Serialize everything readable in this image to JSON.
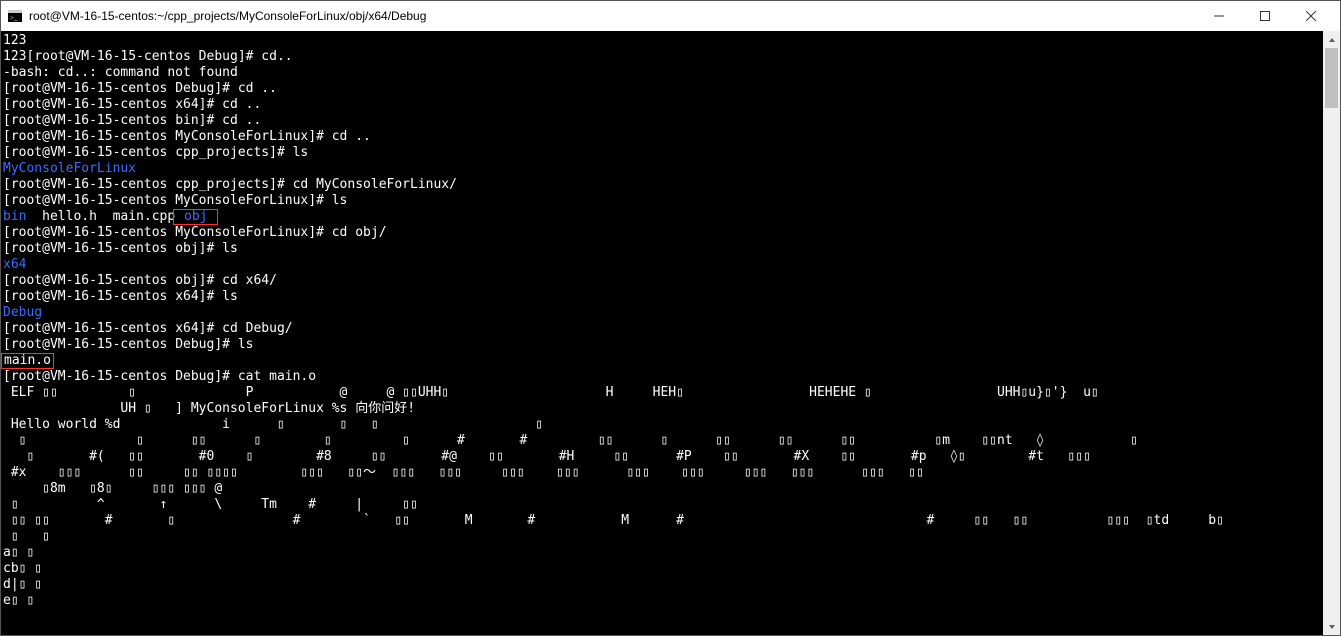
{
  "window": {
    "title": "root@VM-16-15-centos:~/cpp_projects/MyConsoleForLinux/obj/x64/Debug"
  },
  "prompt_parts": {
    "user_host": "root@VM-16-15-centos",
    "dir_debug": "Debug",
    "dir_x64": "x64",
    "dir_bin": "bin",
    "dir_myconsole": "MyConsoleForLinux",
    "dir_cppproj": "cpp_projects",
    "dir_obj": "obj"
  },
  "lines": {
    "l0": "123",
    "l1_a": "123[",
    "l1_b": " Debug]# cd..",
    "l2": "-bash: cd..: command not found",
    "l3_a": "[",
    "l3_b": " Debug]# cd ..",
    "l4_b": " x64]# cd ..",
    "l5_b": " bin]# cd ..",
    "l6_b": " MyConsoleForLinux]# cd ..",
    "l7_b": " cpp_projects]# ls",
    "l8_dir": "MyConsoleForLinux",
    "l9_b": " cpp_projects]# cd MyConsoleForLinux/",
    "l10_b": " MyConsoleForLinux]# ls",
    "l11_bin": "bin",
    "l11_mid": "  hello.h  main.cpp",
    "l11_obj": " obj ",
    "l12_b": " MyConsoleForLinux]# cd obj/",
    "l13_b": " obj]# ls",
    "l14_dir": "x64",
    "l15_b": " obj]# cd x64/",
    "l16_b": " x64]# ls",
    "l17_dir": "Debug",
    "l18_b": " x64]# cd Debug/",
    "l19_b": " Debug]# ls",
    "l20_file": "main.o",
    "l21_b": " Debug]# cat main.o",
    "bin1": " ELF ▯▯         ▯              P           @     @ ▯▯UHH▯                    H     HEH▯                HEHEHE ▯                UHH▯u}▯'}  u▯",
    "bin2": "               UH ▯   ] MyConsoleForLinux %s 向你问好!",
    "bin3": " Hello world %d             i      ▯       ▯   ▯                    ▯",
    "bin4": "  ▯              ▯      ▯▯      ▯        ▯         ▯      #       #         ▯▯      ▯      ▯▯      ▯▯      ▯▯          ▯m    ▯▯nt   ◊           ▯",
    "bin5": "   ▯       #(   ▯▯       #0    ▯        #8     ▯▯       #@    ▯▯       #H     ▯▯      #P    ▯▯       #X    ▯▯       #p   ◊▯        #t   ▯▯▯",
    "bin6": " #x    ▯▯▯      ▯▯     ▯▯ ▯▯▯▯        ▯▯▯   ▯▯〜  ▯▯▯   ▯▯▯     ▯▯▯    ▯▯▯      ▯▯▯    ▯▯▯     ▯▯▯   ▯▯▯      ▯▯▯   ▯▯",
    "bin7": "     ▯8m   ▯8▯     ▯▯▯ ▯▯▯ @",
    "bin8": " ▯          ^       ↑      \\     Tm    #     |     ▯▯",
    "bin9": " ▯▯ ▯▯       #       ▯               #        `   ▯▯       M       #           M      #                               #     ▯▯   ▯▯          ▯▯▯  ▯td     b▯",
    "bin10": " ▯   ▯",
    "bin11": "a▯ ▯",
    "bin12": "cb▯ ▯",
    "bin13": "d|▯ ▯",
    "bin14": "e▯ ▯"
  }
}
